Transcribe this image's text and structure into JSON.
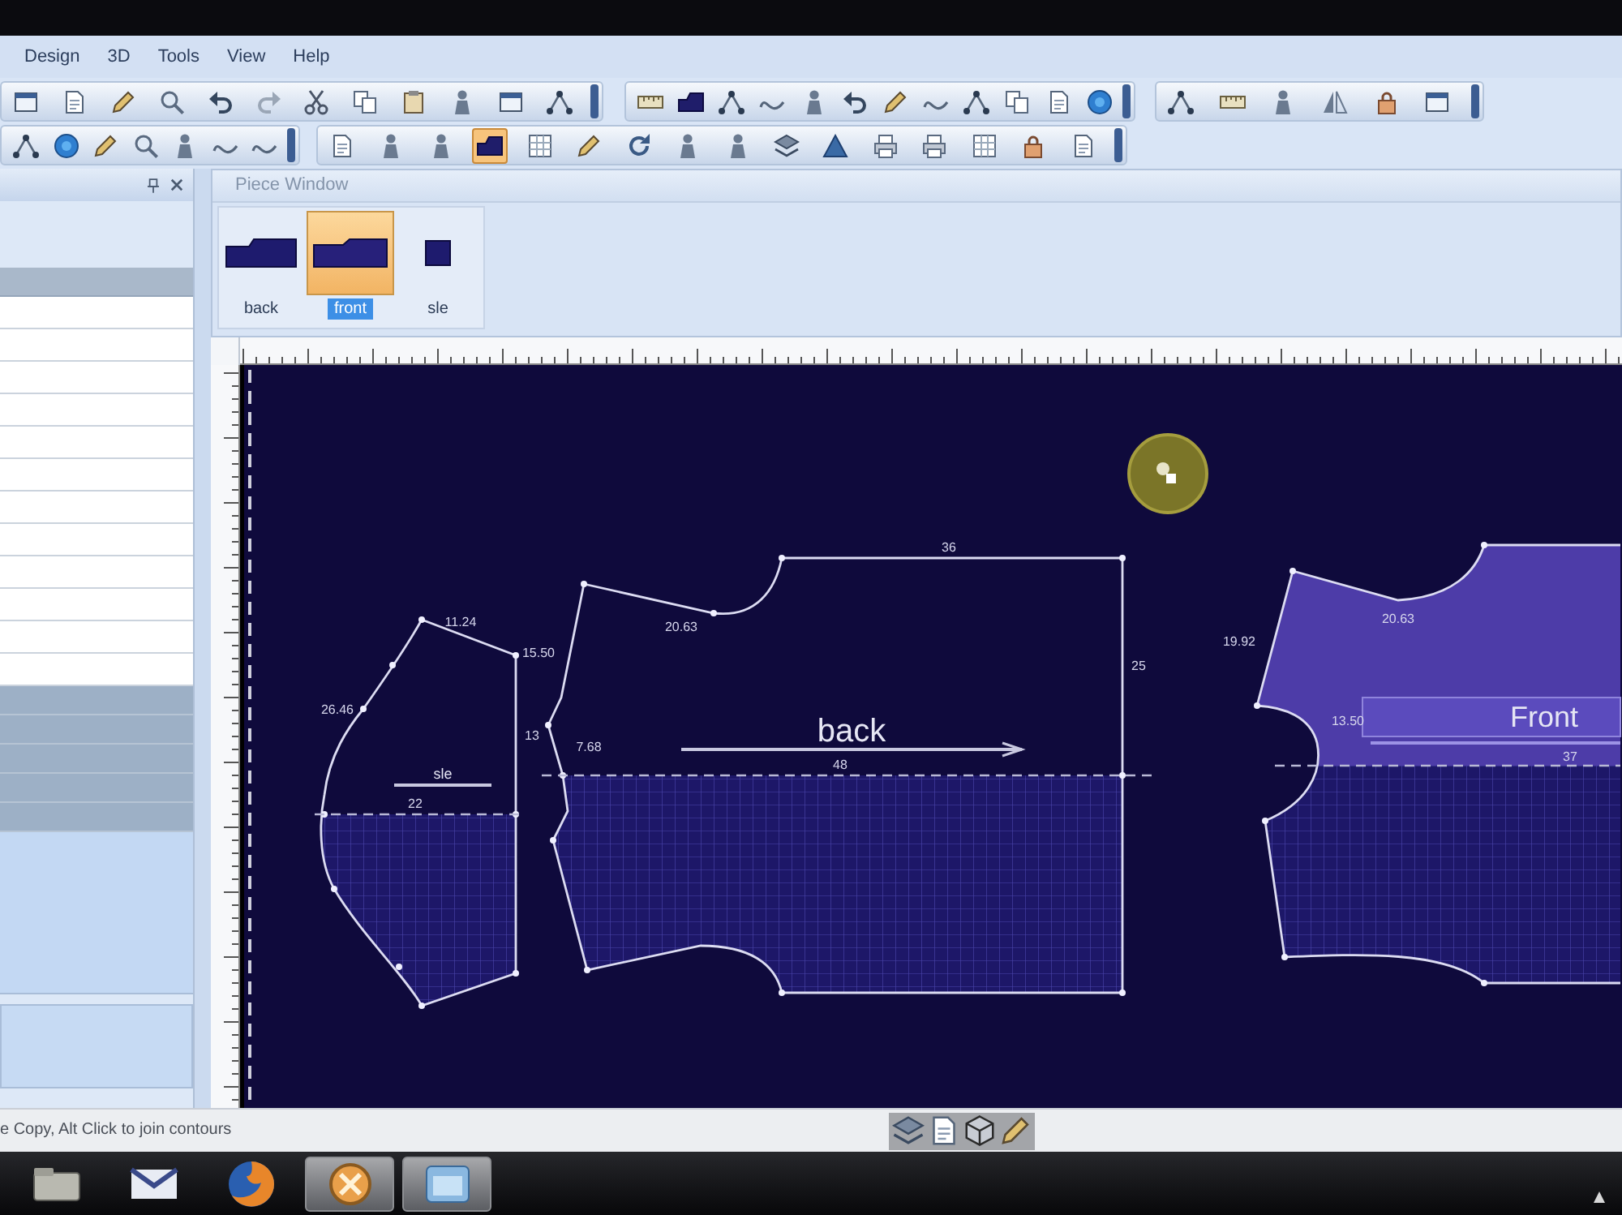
{
  "menu_bar": {
    "items": [
      "Design",
      "3D",
      "Tools",
      "View",
      "Help"
    ]
  },
  "toolbar_rows": [
    [
      {
        "tools": [
          {
            "selected": false
          },
          {
            "selected": false
          },
          {
            "selected": false
          },
          {
            "selected": false
          },
          {
            "selected": false
          },
          {
            "selected": false
          },
          {
            "selected": false
          },
          {
            "selected": false
          },
          {
            "selected": false
          },
          {
            "selected": false
          },
          {
            "selected": false
          },
          {
            "selected": false
          }
        ]
      },
      {
        "tools": [
          {
            "selected": false
          },
          {
            "selected": false
          },
          {
            "selected": false
          },
          {
            "selected": false
          },
          {
            "selected": false
          },
          {
            "selected": false
          },
          {
            "selected": false
          },
          {
            "selected": false
          },
          {
            "selected": false
          },
          {
            "selected": false
          },
          {
            "selected": false
          },
          {
            "selected": false
          }
        ]
      },
      {
        "tools": [
          {
            "selected": false
          },
          {
            "selected": false
          },
          {
            "selected": false
          },
          {
            "selected": false
          },
          {
            "selected": false
          },
          {
            "selected": false
          }
        ]
      }
    ],
    [
      {
        "tools": [
          {
            "selected": false
          },
          {
            "selected": false
          },
          {
            "selected": false
          },
          {
            "selected": false
          },
          {
            "selected": false
          },
          {
            "selected": false
          },
          {
            "selected": false
          }
        ]
      },
      {
        "tools": [
          {
            "selected": false
          },
          {
            "selected": false
          },
          {
            "selected": false
          },
          {
            "selected": true
          },
          {
            "selected": false
          },
          {
            "selected": false
          },
          {
            "selected": false
          },
          {
            "selected": false
          },
          {
            "selected": false
          },
          {
            "selected": false
          },
          {
            "selected": false
          },
          {
            "selected": false
          },
          {
            "selected": false
          },
          {
            "selected": false
          },
          {
            "selected": false
          },
          {
            "selected": false
          }
        ]
      }
    ]
  ],
  "piece_window": {
    "title": "Piece Window",
    "pieces": [
      {
        "label": "back",
        "selected": false
      },
      {
        "label": "front",
        "selected": true
      },
      {
        "label": "sle",
        "selected": false
      }
    ]
  },
  "canvas": {
    "pieces": [
      {
        "kind": "sleeve",
        "label": "sle",
        "selected": false,
        "measurements": [
          "11.24",
          "26.46",
          "13",
          "22"
        ]
      },
      {
        "kind": "back",
        "label": "back",
        "selected": false,
        "measurements": [
          "15.50",
          "7.68",
          "20.63",
          "36",
          "25",
          "48"
        ]
      },
      {
        "kind": "front",
        "label": "Front",
        "selected": true,
        "measurements": [
          "20.63",
          "19.92",
          "13.50",
          "37"
        ]
      }
    ]
  },
  "status_bar": {
    "text": "e Copy, Alt Click to join contours"
  }
}
